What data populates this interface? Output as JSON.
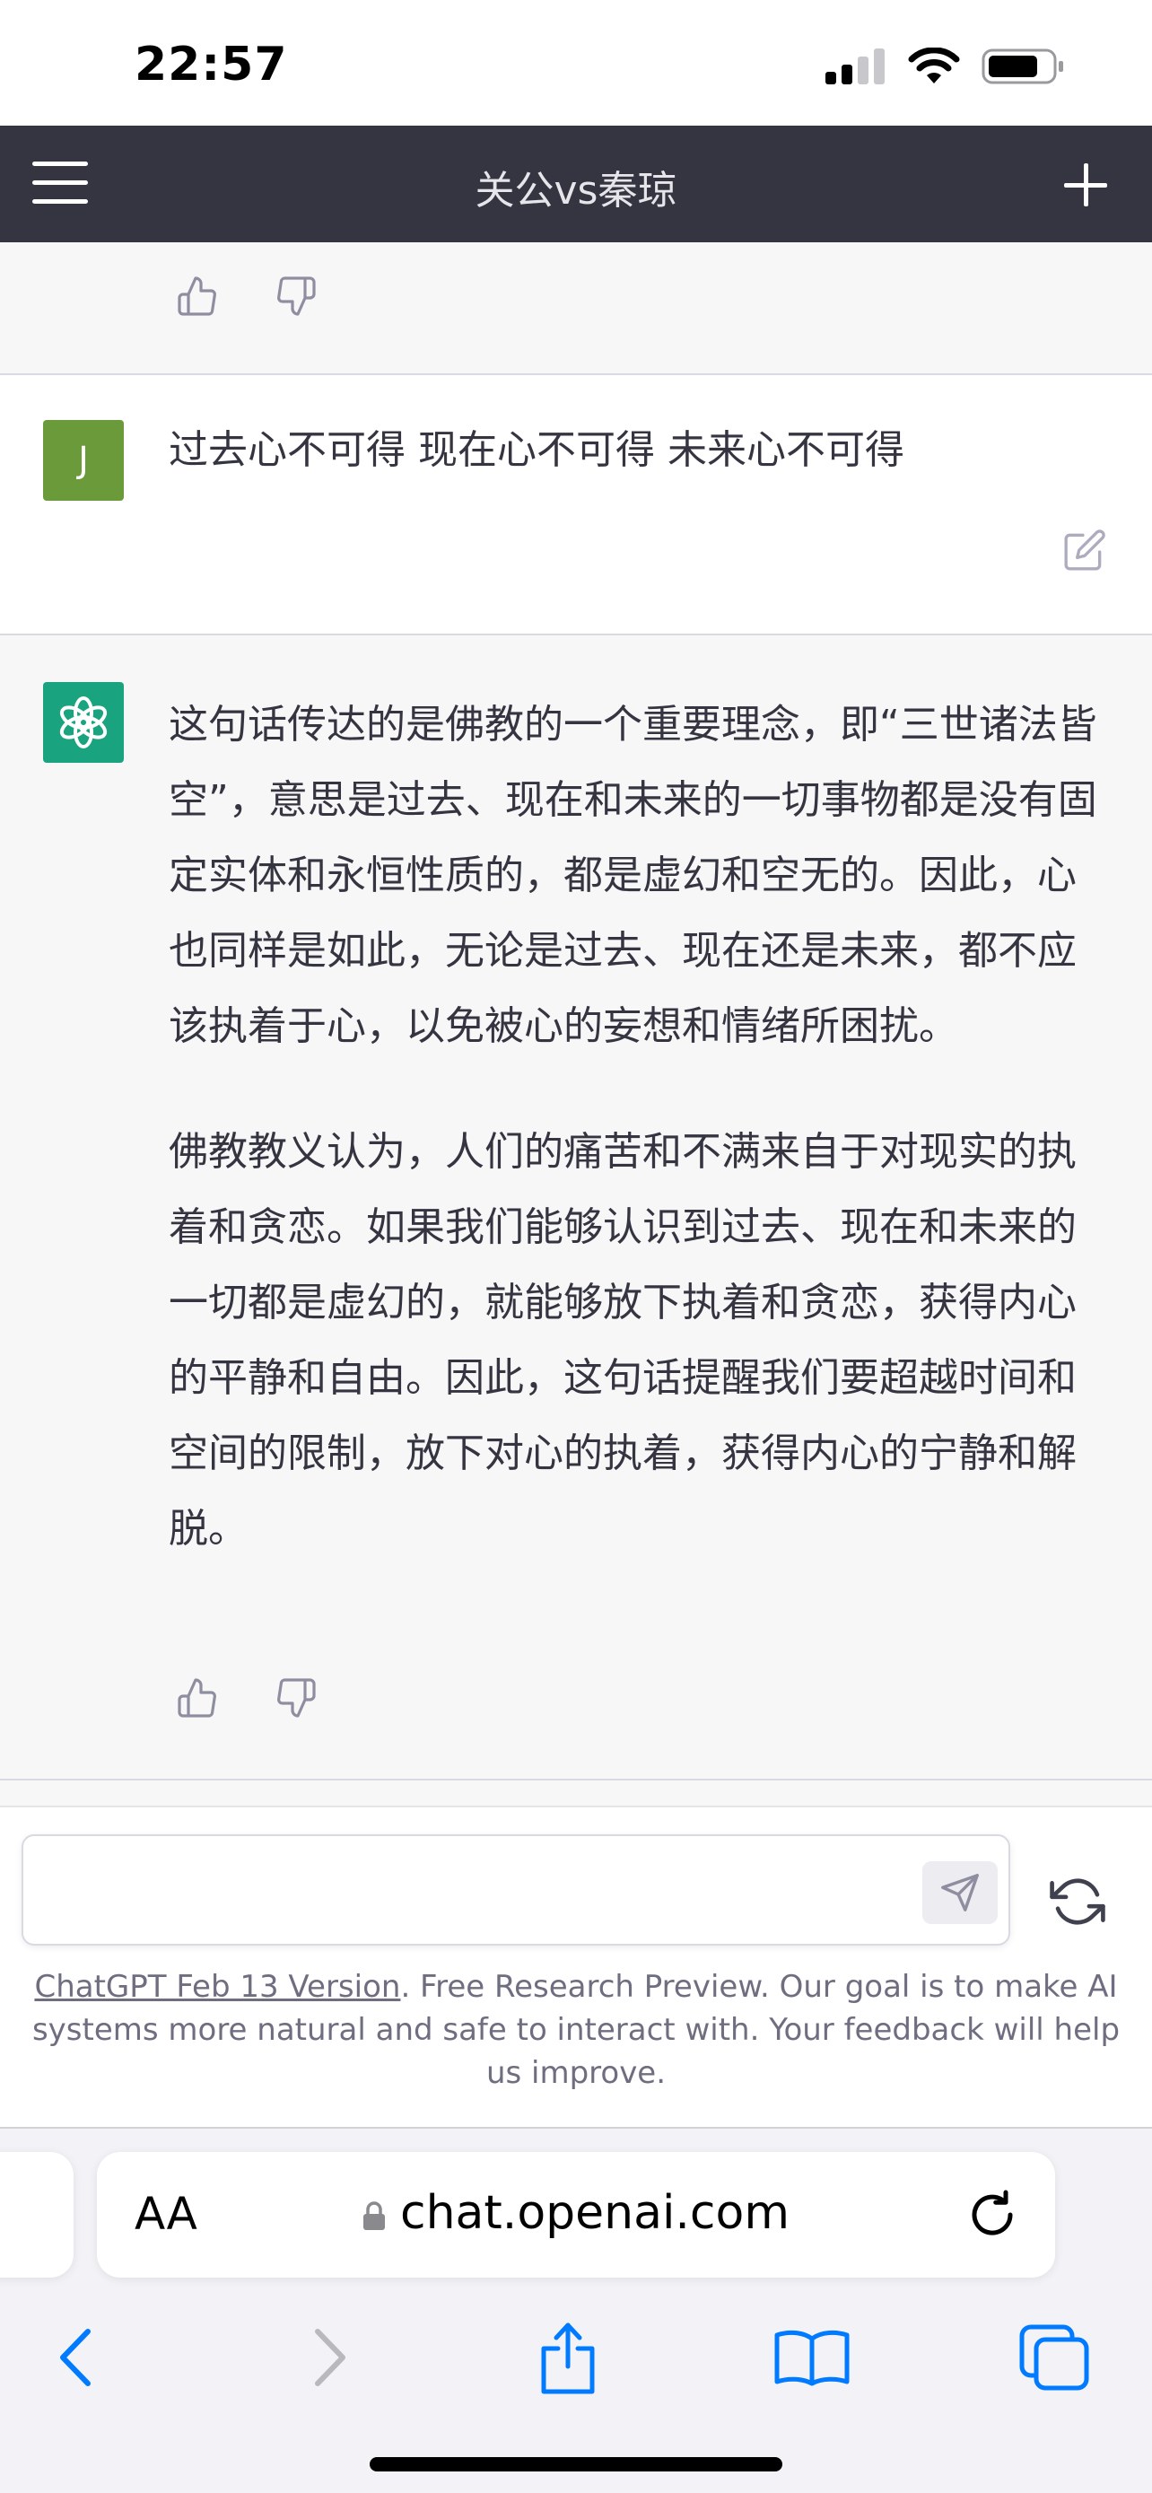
{
  "status_bar": {
    "time": "22:57"
  },
  "header": {
    "title": "关公vs秦琼"
  },
  "conversation": {
    "user_message": {
      "avatar_letter": "J",
      "text": "过去心不可得 现在心不可得 未来心不可得"
    },
    "assistant_message": {
      "paragraphs": [
        "这句话传达的是佛教的一个重要理念，即“三世诸法皆空”，意思是过去、现在和未来的一切事物都是没有固定实体和永恒性质的，都是虚幻和空无的。因此，心也同样是如此，无论是过去、现在还是未来，都不应该执着于心，以免被心的妄想和情绪所困扰。",
        "佛教教义认为，人们的痛苦和不满来自于对现实的执着和贪恋。如果我们能够认识到过去、现在和未来的一切都是虚幻的，就能够放下执着和贪恋，获得内心的平静和自由。因此，这句话提醒我们要超越时间和空间的限制，放下对心的执着，获得内心的宁静和解脱。"
      ]
    }
  },
  "composer": {
    "placeholder": "",
    "footnote_link": "ChatGPT Feb 13 Version",
    "footnote_text": ". Free Research Preview. Our goal is to make AI systems more natural and safe to interact with. Your feedback will help us improve."
  },
  "browser": {
    "text_size_label": "AA",
    "url": "chat.openai.com"
  },
  "colors": {
    "header_bg": "#343541",
    "user_avatar": "#6b9a3a",
    "assistant_avatar": "#19a37f",
    "ios_blue": "#007aff"
  }
}
